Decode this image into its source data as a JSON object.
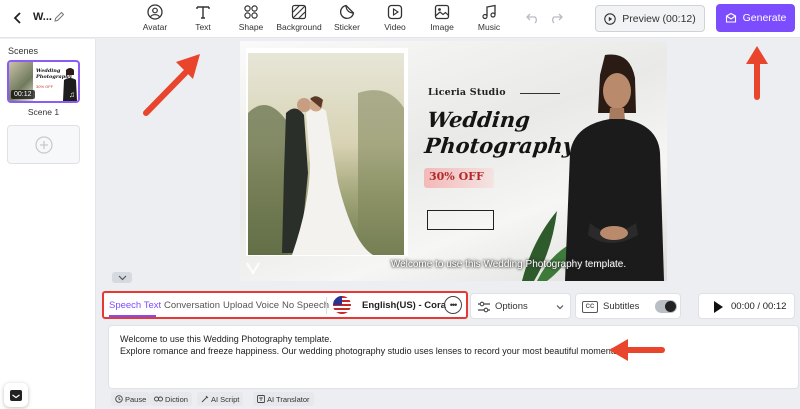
{
  "project": {
    "name": "W..."
  },
  "toolbar": {
    "tools": [
      {
        "label": "Avatar",
        "icon": "avatar-icon"
      },
      {
        "label": "Text",
        "icon": "text-icon"
      },
      {
        "label": "Shape",
        "icon": "shape-icon"
      },
      {
        "label": "Background",
        "icon": "background-icon"
      },
      {
        "label": "Sticker",
        "icon": "sticker-icon"
      },
      {
        "label": "Video",
        "icon": "video-icon"
      },
      {
        "label": "Image",
        "icon": "image-icon"
      },
      {
        "label": "Music",
        "icon": "music-icon"
      }
    ],
    "preview_label": "Preview (00:12)",
    "generate_label": "Generate"
  },
  "sidebar": {
    "title": "Scenes",
    "scenes": [
      {
        "label": "Scene 1",
        "duration": "00:12"
      }
    ]
  },
  "canvas": {
    "studio_name": "Liceria Studio",
    "title_line1": "Wedding",
    "title_line2": "Photography",
    "promo": "30% OFF",
    "caption": "Welcome to use this Wedding Photography template."
  },
  "speech_panel": {
    "tabs": [
      "Speech Text",
      "Conversation",
      "Upload Voice",
      "No Speech"
    ],
    "active_tab": "Speech Text",
    "voice": "English(US) - Cora",
    "options_label": "Options",
    "subtitles_label": "Subtitles",
    "subtitles_on": true,
    "player_time": "00:00 / 00:12",
    "text_line1": "Welcome to use this Wedding Photography template.",
    "text_line2": "Explore romance and freeze happiness. Our wedding photography studio uses lenses to record your most beautiful moments.",
    "tools": [
      "Pause",
      "Diction",
      "AI Script",
      "AI Translator"
    ]
  },
  "colors": {
    "accent": "#7c4dff",
    "highlight_border": "#e53935",
    "arrow": "#e8452c"
  }
}
